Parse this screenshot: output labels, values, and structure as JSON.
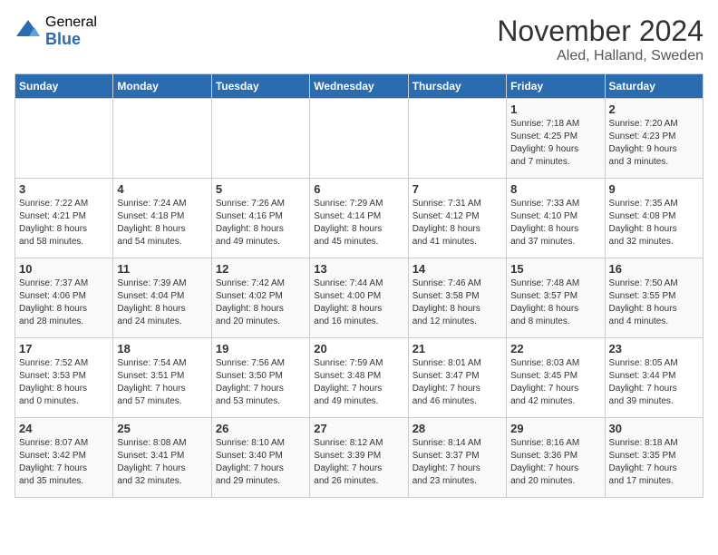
{
  "logo": {
    "general": "General",
    "blue": "Blue"
  },
  "header": {
    "title": "November 2024",
    "subtitle": "Aled, Halland, Sweden"
  },
  "days_of_week": [
    "Sunday",
    "Monday",
    "Tuesday",
    "Wednesday",
    "Thursday",
    "Friday",
    "Saturday"
  ],
  "weeks": [
    [
      {
        "day": "",
        "info": ""
      },
      {
        "day": "",
        "info": ""
      },
      {
        "day": "",
        "info": ""
      },
      {
        "day": "",
        "info": ""
      },
      {
        "day": "",
        "info": ""
      },
      {
        "day": "1",
        "info": "Sunrise: 7:18 AM\nSunset: 4:25 PM\nDaylight: 9 hours\nand 7 minutes."
      },
      {
        "day": "2",
        "info": "Sunrise: 7:20 AM\nSunset: 4:23 PM\nDaylight: 9 hours\nand 3 minutes."
      }
    ],
    [
      {
        "day": "3",
        "info": "Sunrise: 7:22 AM\nSunset: 4:21 PM\nDaylight: 8 hours\nand 58 minutes."
      },
      {
        "day": "4",
        "info": "Sunrise: 7:24 AM\nSunset: 4:18 PM\nDaylight: 8 hours\nand 54 minutes."
      },
      {
        "day": "5",
        "info": "Sunrise: 7:26 AM\nSunset: 4:16 PM\nDaylight: 8 hours\nand 49 minutes."
      },
      {
        "day": "6",
        "info": "Sunrise: 7:29 AM\nSunset: 4:14 PM\nDaylight: 8 hours\nand 45 minutes."
      },
      {
        "day": "7",
        "info": "Sunrise: 7:31 AM\nSunset: 4:12 PM\nDaylight: 8 hours\nand 41 minutes."
      },
      {
        "day": "8",
        "info": "Sunrise: 7:33 AM\nSunset: 4:10 PM\nDaylight: 8 hours\nand 37 minutes."
      },
      {
        "day": "9",
        "info": "Sunrise: 7:35 AM\nSunset: 4:08 PM\nDaylight: 8 hours\nand 32 minutes."
      }
    ],
    [
      {
        "day": "10",
        "info": "Sunrise: 7:37 AM\nSunset: 4:06 PM\nDaylight: 8 hours\nand 28 minutes."
      },
      {
        "day": "11",
        "info": "Sunrise: 7:39 AM\nSunset: 4:04 PM\nDaylight: 8 hours\nand 24 minutes."
      },
      {
        "day": "12",
        "info": "Sunrise: 7:42 AM\nSunset: 4:02 PM\nDaylight: 8 hours\nand 20 minutes."
      },
      {
        "day": "13",
        "info": "Sunrise: 7:44 AM\nSunset: 4:00 PM\nDaylight: 8 hours\nand 16 minutes."
      },
      {
        "day": "14",
        "info": "Sunrise: 7:46 AM\nSunset: 3:58 PM\nDaylight: 8 hours\nand 12 minutes."
      },
      {
        "day": "15",
        "info": "Sunrise: 7:48 AM\nSunset: 3:57 PM\nDaylight: 8 hours\nand 8 minutes."
      },
      {
        "day": "16",
        "info": "Sunrise: 7:50 AM\nSunset: 3:55 PM\nDaylight: 8 hours\nand 4 minutes."
      }
    ],
    [
      {
        "day": "17",
        "info": "Sunrise: 7:52 AM\nSunset: 3:53 PM\nDaylight: 8 hours\nand 0 minutes."
      },
      {
        "day": "18",
        "info": "Sunrise: 7:54 AM\nSunset: 3:51 PM\nDaylight: 7 hours\nand 57 minutes."
      },
      {
        "day": "19",
        "info": "Sunrise: 7:56 AM\nSunset: 3:50 PM\nDaylight: 7 hours\nand 53 minutes."
      },
      {
        "day": "20",
        "info": "Sunrise: 7:59 AM\nSunset: 3:48 PM\nDaylight: 7 hours\nand 49 minutes."
      },
      {
        "day": "21",
        "info": "Sunrise: 8:01 AM\nSunset: 3:47 PM\nDaylight: 7 hours\nand 46 minutes."
      },
      {
        "day": "22",
        "info": "Sunrise: 8:03 AM\nSunset: 3:45 PM\nDaylight: 7 hours\nand 42 minutes."
      },
      {
        "day": "23",
        "info": "Sunrise: 8:05 AM\nSunset: 3:44 PM\nDaylight: 7 hours\nand 39 minutes."
      }
    ],
    [
      {
        "day": "24",
        "info": "Sunrise: 8:07 AM\nSunset: 3:42 PM\nDaylight: 7 hours\nand 35 minutes."
      },
      {
        "day": "25",
        "info": "Sunrise: 8:08 AM\nSunset: 3:41 PM\nDaylight: 7 hours\nand 32 minutes."
      },
      {
        "day": "26",
        "info": "Sunrise: 8:10 AM\nSunset: 3:40 PM\nDaylight: 7 hours\nand 29 minutes."
      },
      {
        "day": "27",
        "info": "Sunrise: 8:12 AM\nSunset: 3:39 PM\nDaylight: 7 hours\nand 26 minutes."
      },
      {
        "day": "28",
        "info": "Sunrise: 8:14 AM\nSunset: 3:37 PM\nDaylight: 7 hours\nand 23 minutes."
      },
      {
        "day": "29",
        "info": "Sunrise: 8:16 AM\nSunset: 3:36 PM\nDaylight: 7 hours\nand 20 minutes."
      },
      {
        "day": "30",
        "info": "Sunrise: 8:18 AM\nSunset: 3:35 PM\nDaylight: 7 hours\nand 17 minutes."
      }
    ]
  ]
}
